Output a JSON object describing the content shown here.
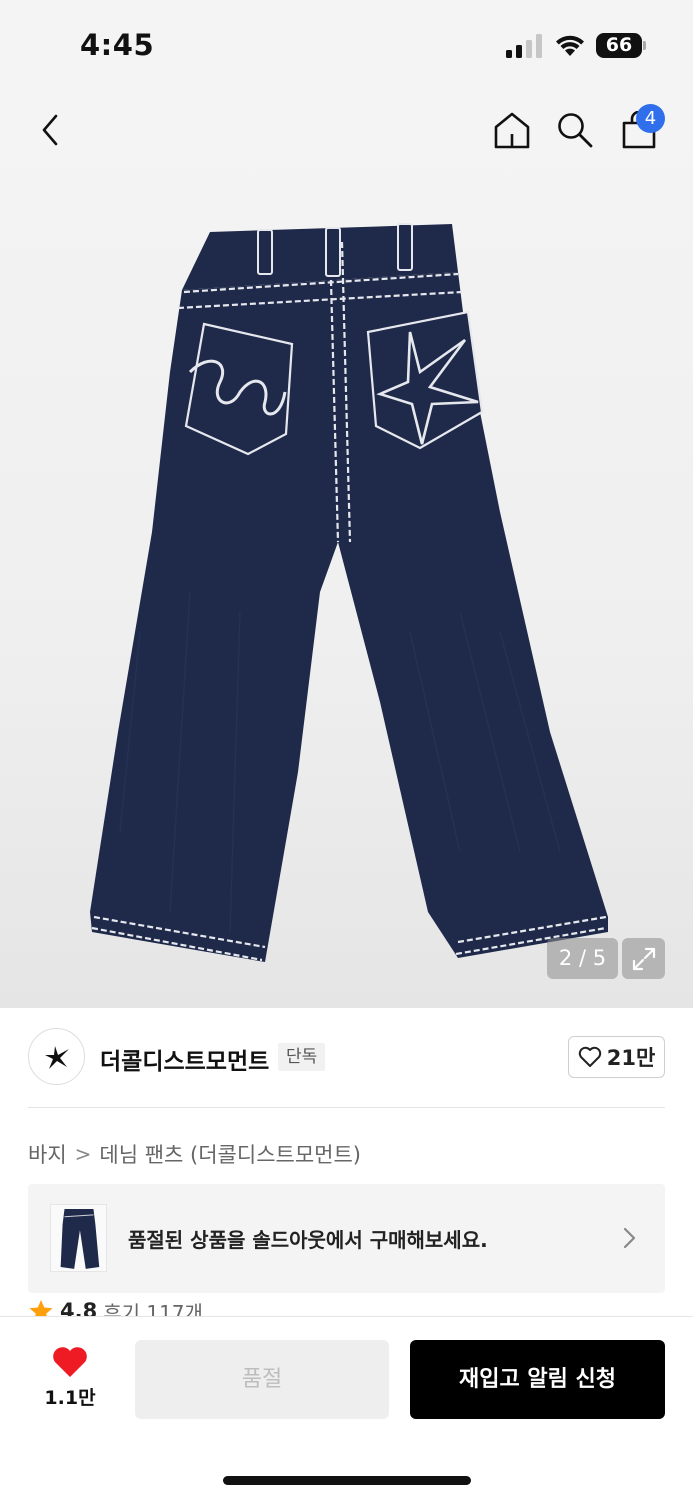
{
  "status_bar": {
    "time": "4:45",
    "battery": "66"
  },
  "header": {
    "cart_badge": "4"
  },
  "gallery": {
    "page_indicator": "2 / 5"
  },
  "brand": {
    "name": "더콜디스트모먼트",
    "badge": "단독",
    "like_count": "21만"
  },
  "breadcrumb": {
    "category": "바지",
    "separator": ">",
    "subcategory": "데님 팬츠 (더콜디스트모먼트)"
  },
  "soldout_banner": {
    "text": "품절된 상품을 솔드아웃에서 구매해보세요."
  },
  "rating": {
    "score": "4.8",
    "reviews": "후기 117개"
  },
  "bottom_bar": {
    "wish_count": "1.1만",
    "soldout_label": "품절",
    "restock_label": "재입고 알림 신청"
  },
  "colors": {
    "accent_blue": "#2f6fec",
    "wish_red": "#ee1b24",
    "star_orange": "#ff9f0a",
    "denim": "#1f2a4a"
  }
}
